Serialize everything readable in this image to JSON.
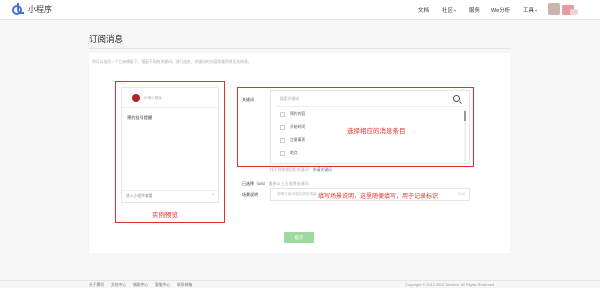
{
  "header": {
    "app_title": "小程序",
    "nav": [
      {
        "label": "文档",
        "has_dropdown": false
      },
      {
        "label": "社区",
        "has_dropdown": true
      },
      {
        "label": "服务",
        "has_dropdown": false
      },
      {
        "label": "We分析",
        "has_dropdown": false
      },
      {
        "label": "工具",
        "has_dropdown": true
      }
    ]
  },
  "page": {
    "title": "订阅消息",
    "description": "你可以选用一个已有模板下，搭配不同的关键词，进行组合，关键词的内容和顺序将无法修改。"
  },
  "preview": {
    "app_name": "示例小程序",
    "message_title": "预约挂号提醒",
    "footer_label": "进入小程序查看",
    "footer_arrow": "›"
  },
  "keywords": {
    "label": "关键词",
    "search_placeholder": "搜索关键词",
    "options": [
      "预约内容",
      "开始时间",
      "注意事项",
      "地点"
    ],
    "tip": "找不到你想用的关键词？",
    "tip_link": "申请关键词"
  },
  "selected": {
    "label": "已选择（0/5）",
    "hint": "最多从上方选择关键词"
  },
  "scene": {
    "label": "场景说明",
    "placeholder": "说明订阅消息的使用场景",
    "counter": "0/15"
  },
  "submit_label": "提交",
  "annotations": {
    "left": "实例预览",
    "right": "选择相应的消息条目",
    "scene": "填写场景说明，这里随便填写，用于记录标识"
  },
  "footer": {
    "links": [
      "关于腾讯",
      "文档中心",
      "辅助中心",
      "客服中心",
      "联系邮箱"
    ],
    "copyright": "Copyright © 2012-2022 Tencent. All Rights Reserved."
  },
  "colors": {
    "annotation": "#e3312d",
    "submit_disabled": "#9ed99d",
    "brand": "#4a6ee0"
  }
}
